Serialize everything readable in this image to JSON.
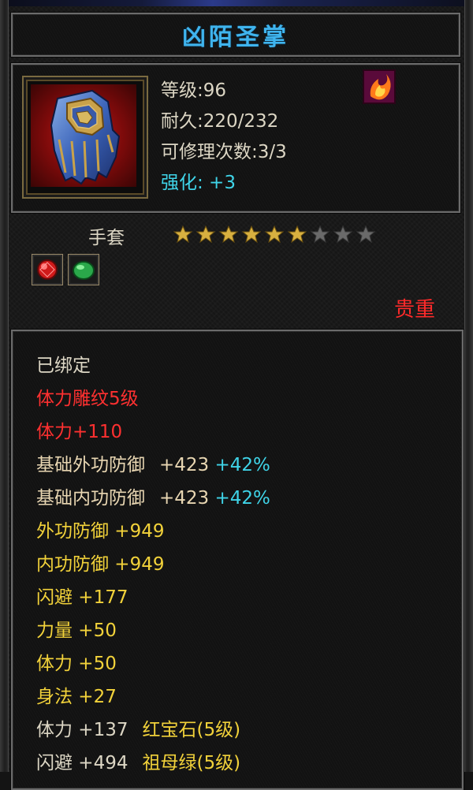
{
  "item": {
    "name": "凶陌圣掌",
    "level": "等级:96",
    "durability": "耐久:220/232",
    "repair": "可修理次数:3/3",
    "enhance": "强化: +3",
    "type": "手套",
    "stars": {
      "filled": 6,
      "total": 9
    },
    "rarity": "贵重"
  },
  "attributes": {
    "bound": "已绑定",
    "engrave": "体力雕纹5级",
    "stamina_bonus": "体力+110",
    "base_ext_def_label": "基础外功防御",
    "base_ext_def_value": "+423",
    "base_ext_def_pct": "+42%",
    "base_int_def_label": "基础内功防御",
    "base_int_def_value": "+423",
    "base_int_def_pct": "+42%",
    "ext_def": "外功防御 +949",
    "int_def": "内功防御 +949",
    "dodge": "闪避 +177",
    "strength": "力量 +50",
    "stamina": "体力 +50",
    "agility": "身法 +27",
    "gem1_stat": "体力 +137",
    "gem1_name": "红宝石(5级)",
    "gem2_stat": "闪避 +494",
    "gem2_name": "祖母绿(5级)"
  },
  "icons": {
    "item": "gauntlet-icon",
    "badge": "flame-badge-icon",
    "gem_slot_1": "ruby-gem-icon",
    "gem_slot_2": "emerald-gem-icon"
  },
  "colors": {
    "title": "#3fb4ee",
    "enhance": "#3fd4e8",
    "rarity": "#ff2a2a",
    "engrave": "#ff3030",
    "base_def": "#e8d6b2",
    "stat": "#f2d23a",
    "star_filled": "#d8b040",
    "star_empty": "#6a6a6a"
  }
}
